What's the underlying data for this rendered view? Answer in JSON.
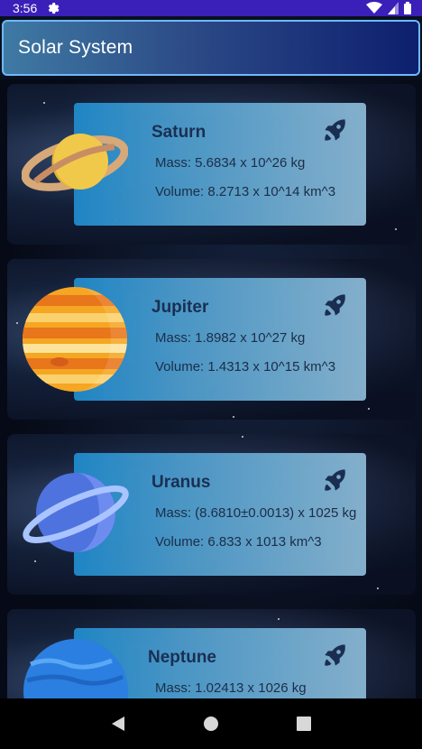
{
  "status_bar": {
    "time": "3:56"
  },
  "app_bar": {
    "title": "Solar System"
  },
  "planets": [
    {
      "name": "Saturn",
      "mass": "Mass: 5.6834 x 10^26 kg",
      "volume": "Volume: 8.2713 x 10^14 km^3"
    },
    {
      "name": "Jupiter",
      "mass": "Mass: 1.8982 x 10^27 kg",
      "volume": "Volume: 1.4313 x 10^15 km^3"
    },
    {
      "name": "Uranus",
      "mass": "Mass: (8.6810±0.0013) x 1025 kg",
      "volume": "Volume: 6.833 x 1013 km^3"
    },
    {
      "name": "Neptune",
      "mass": "Mass: 1.02413 x 1026 kg",
      "volume": ""
    }
  ],
  "icons": {
    "status": [
      "gear-icon",
      "wifi-icon",
      "signal-icon",
      "battery-icon"
    ],
    "card": "rocket-icon",
    "nav": [
      "back-icon",
      "home-icon",
      "recents-icon"
    ]
  },
  "colors": {
    "status_bar": "#3a1fb8",
    "app_bar_border": "#6fb8ff",
    "panel_start": "#1f88c8",
    "panel_end": "#88b4d0",
    "planet_name": "#1a2f52"
  }
}
